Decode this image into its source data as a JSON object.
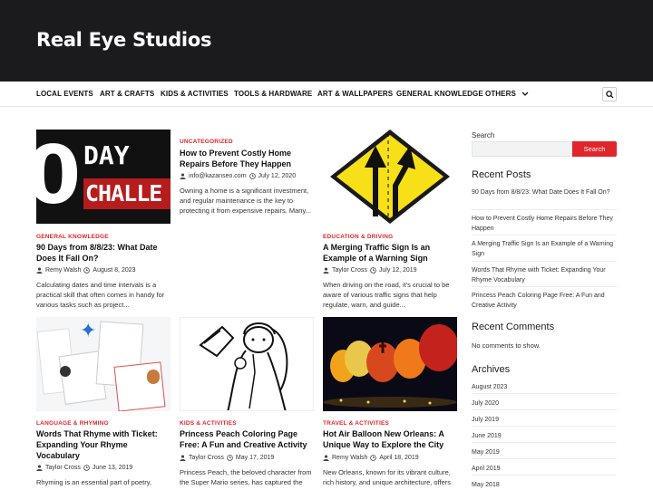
{
  "site": {
    "title": "Real Eye Studios"
  },
  "nav": {
    "items": [
      "LOCAL EVENTS",
      "ART & CRAFTS",
      "KIDS & ACTIVITIES",
      "TOOLS & HARDWARE",
      "ART & WALLPAPERS",
      "GENERAL KNOWLEDGE",
      "OTHERS"
    ],
    "search_icon": "search-icon"
  },
  "thumb_text": {
    "day": "DAY",
    "zero": "0",
    "challenge": "CHALLE"
  },
  "posts": [
    {
      "category": "GENERAL KNOWLEDGE",
      "title": "90 Days from 8/8/23: What Date Does It Fall On?",
      "author": "Remy Walsh",
      "date": "August 8, 2023",
      "excerpt": "Calculating dates and time intervals is a practical skill that often comes in handy for various tasks such as project..."
    },
    {
      "category": "UNCATEGORIZED",
      "title": "How to Prevent Costly Home Repairs Before They Happen",
      "author": "info@kazanseo.com",
      "date": "July 12, 2020",
      "excerpt": "Owning a home is a significant investment, and regular maintenance is the key to protecting it from expensive repairs. Many..."
    },
    {
      "category": "EDUCATION & DRIVING",
      "title": "A Merging Traffic Sign Is an Example of a Warning Sign",
      "author": "Taylor Cross",
      "date": "July 12, 2019",
      "excerpt": "When driving on the road, it's crucial to be aware of various traffic signs that help regulate, warn, and guide..."
    },
    {
      "category": "LANGUAGE & RHYMING",
      "title": "Words That Rhyme with Ticket: Expanding Your Rhyme Vocabulary",
      "author": "Taylor Cross",
      "date": "June 13, 2019",
      "excerpt": "Rhyming is an essential part of poetry,"
    },
    {
      "category": "KIDS & ACTIVITIES",
      "title": "Princess Peach Coloring Page Free: A Fun and Creative Activity",
      "author": "Taylor Cross",
      "date": "May 17, 2019",
      "excerpt": "Princess Peach, the beloved character from the Super Mario series, has captured the"
    },
    {
      "category": "TRAVEL & ACTIVITIES",
      "title": "Hot Air Balloon New Orleans: A Unique Way to Explore the City",
      "author": "Remy Walsh",
      "date": "April 18, 2019",
      "excerpt": "New Orleans, known for its vibrant culture, rich history, and unique architecture, offers"
    }
  ],
  "sidebar": {
    "search_label": "Search",
    "search_button": "Search",
    "search_value": "",
    "recent_posts_heading": "Recent Posts",
    "recent_posts": [
      "90 Days from 8/8/23: What Date Does It Fall On?",
      "How to Prevent Costly Home Repairs Before They Happen",
      "A Merging Traffic Sign Is an Example of a Warning Sign",
      "Words That Rhyme with Ticket: Expanding Your Rhyme Vocabulary",
      "Princess Peach Coloring Page Free: A Fun and Creative Activity"
    ],
    "recent_comments_heading": "Recent Comments",
    "no_comments": "No comments to show.",
    "archives_heading": "Archives",
    "archives": [
      "August 2023",
      "July 2020",
      "July 2019",
      "June 2019",
      "May 2019",
      "April 2019",
      "May 2018"
    ]
  },
  "colors": {
    "topbar": "#1b1b1d",
    "accent": "#e0252b"
  }
}
